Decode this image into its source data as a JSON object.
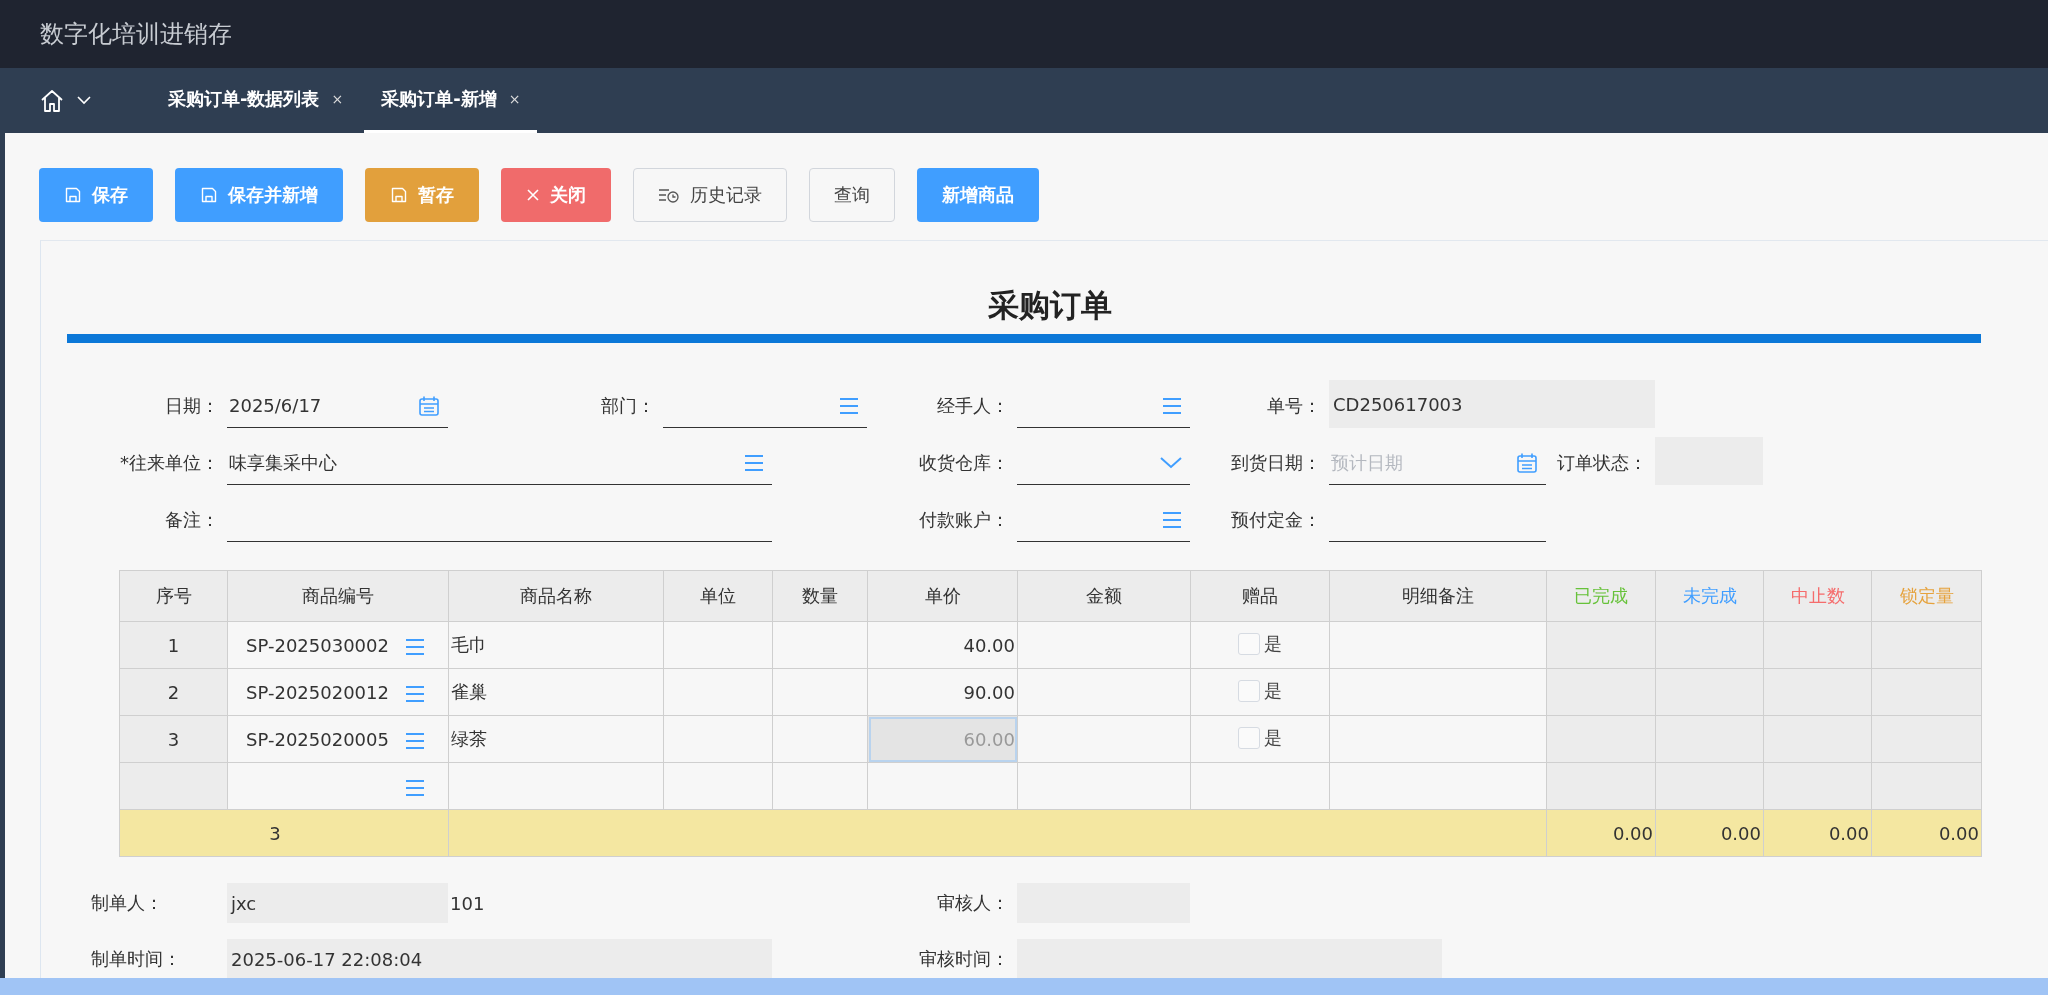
{
  "app_title": "数字化培训进销存",
  "tabs": [
    {
      "label": "采购订单-数据列表",
      "close": "×",
      "selected": false
    },
    {
      "label": "采购订单-新增",
      "close": "×",
      "selected": true
    }
  ],
  "toolbar": [
    {
      "label": "保存",
      "kind": "save"
    },
    {
      "label": "保存并新增",
      "kind": "save"
    },
    {
      "label": "暂存",
      "kind": "draft"
    },
    {
      "label": "关闭",
      "kind": "close"
    },
    {
      "label": "历史记录",
      "kind": "history"
    },
    {
      "label": "查询",
      "kind": "plain"
    },
    {
      "label": "新增商品",
      "kind": "add"
    }
  ],
  "form_title": "采购订单",
  "form_fields": [
    {
      "label": "日期：",
      "kind": "date",
      "value": "2025/6/17"
    },
    {
      "label": "部门：",
      "kind": "lookup"
    },
    {
      "label": "经手人：",
      "kind": "lookup"
    },
    {
      "label": "单号：",
      "kind": "readonly",
      "value": "CD250617003"
    },
    {
      "label": "*往来单位：",
      "kind": "lookup",
      "value": "味享集采中心"
    },
    {
      "label": "收货仓库：",
      "kind": "select"
    },
    {
      "label": "到货日期：",
      "kind": "date",
      "placeholder": "预计日期"
    },
    {
      "label": "订单状态：",
      "kind": "readonly"
    },
    {
      "label": "备注：",
      "kind": "text"
    },
    {
      "label": "付款账户：",
      "kind": "lookup"
    },
    {
      "label": "预付定金：",
      "kind": "text"
    }
  ],
  "table": {
    "columns": [
      {
        "label": "序号"
      },
      {
        "label": "商品编号"
      },
      {
        "label": "商品名称"
      },
      {
        "label": "单位"
      },
      {
        "label": "数量"
      },
      {
        "label": "单价"
      },
      {
        "label": "金额"
      },
      {
        "label": "赠品"
      },
      {
        "label": "明细备注"
      },
      {
        "label": "已完成",
        "color": "#67c23a"
      },
      {
        "label": "未完成",
        "color": "#409eff"
      },
      {
        "label": "中止数",
        "color": "#f56c6c"
      },
      {
        "label": "锁定量",
        "color": "#e6a23c"
      }
    ],
    "rows": [
      {
        "no": "1",
        "code": "SP-2025030002",
        "name": "毛巾",
        "price": "40.00",
        "price_active": false,
        "gift_label": "是",
        "gift_checked": false
      },
      {
        "no": "2",
        "code": "SP-2025020012",
        "name": "雀巢",
        "price": "90.00",
        "price_active": false,
        "gift_label": "是",
        "gift_checked": false
      },
      {
        "no": "3",
        "code": "SP-2025020005",
        "name": "绿茶",
        "price": "60.00",
        "price_active": true,
        "gift_label": "是",
        "gift_checked": false
      }
    ],
    "new_row": true,
    "summary": {
      "count": "3",
      "completed": "0.00",
      "incomplete": "0.00",
      "stopped": "0.00",
      "locked": "0.00"
    }
  },
  "footer": {
    "creator_label": "制单人：",
    "creator": "jxc",
    "creator_code": "101",
    "reviewer_label": "审核人：",
    "created_label": "制单时间：",
    "created_time": "2025-06-17 22:08:04",
    "review_time_label": "审核时间："
  }
}
